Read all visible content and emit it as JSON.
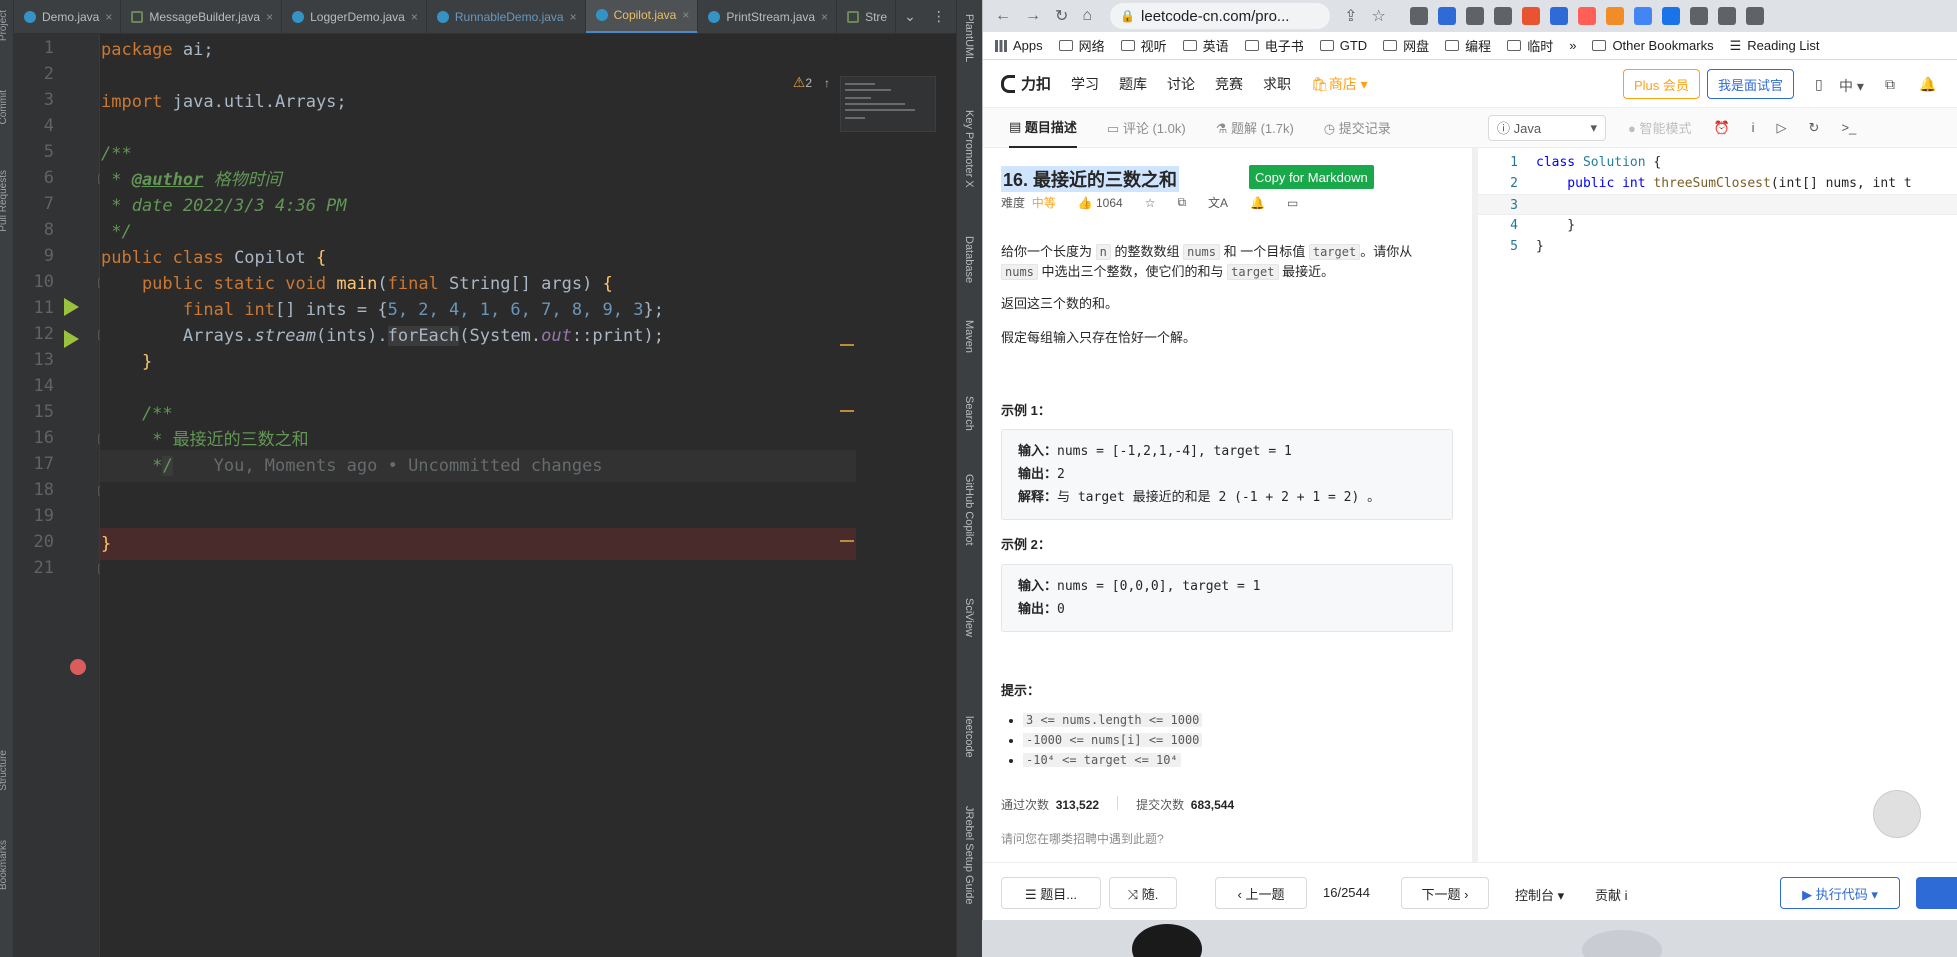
{
  "ide": {
    "tabs": [
      {
        "label": "Demo.java"
      },
      {
        "label": "MessageBuilder.java"
      },
      {
        "label": "LoggerDemo.java"
      },
      {
        "label": "RunnableDemo.java"
      },
      {
        "label": "Copilot.java"
      },
      {
        "label": "PrintStream.java"
      },
      {
        "label": "Stre"
      }
    ],
    "tab_close": "×",
    "tab_more": "⌄",
    "warning_count": "2",
    "left_tools": [
      "Project",
      "Commit",
      "Pull Requests",
      "Structure",
      "Bookmarks"
    ],
    "right_tools": [
      "PlantUML",
      "Key Promoter X",
      "Database",
      "Maven",
      "Search",
      "GitHub Copilot",
      "SciView",
      "leetcode",
      "JRebel Setup Guide"
    ],
    "line_numbers": [
      "1",
      "2",
      "3",
      "4",
      "5",
      "6",
      "7",
      "8",
      "9",
      "10",
      "11",
      "12",
      "13",
      "14",
      "15",
      "16",
      "17",
      "18",
      "19",
      "20",
      "21"
    ],
    "code": {
      "l1_kw": "package",
      "l1_rest": " ai;",
      "l3_kw": "import",
      "l3_rest": " java.util.Arrays;",
      "l5": "/**",
      "l6_a": " * ",
      "l6_ann": "@author",
      "l6_b": " 格物时间",
      "l7": " * date 2022/3/3 4:36 PM",
      "l8": " */",
      "l9_kw": "public class",
      "l9_name": " Copilot ",
      "l9_br": "{",
      "l10_kw": "    public static void",
      "l10_fn": " main",
      "l10_a": "(",
      "l10_kw2": "final",
      "l10_b": " String[] args) ",
      "l10_br": "{",
      "l11_kw": "        final int",
      "l11_a": "[] ints = {",
      "l11_nums": "5, 2, 4, 1, 6, 7, 8, 9, 3",
      "l11_b": "};",
      "l12_a": "        Arrays.",
      "l12_stream": "stream",
      "l12_b": "(ints).",
      "l12_fe": "forEach",
      "l12_c": "(System.",
      "l12_out": "out",
      "l12_d": "::print);",
      "l13": "    }",
      "l15": "    /**",
      "l16": "     * 最接近的三数之和",
      "l17_a": "     *",
      "l17_caret": "/",
      "l17_ghost": "    You, Moments ago • Uncommitted changes",
      "l20": "}"
    }
  },
  "browser": {
    "url": "leetcode-cn.com/pro...",
    "bookmarks": [
      "Apps",
      "网络",
      "视听",
      "英语",
      "电子书",
      "GTD",
      "网盘",
      "编程",
      "临时"
    ],
    "bookmarks_more": "»",
    "other_bookmarks": "Other Bookmarks",
    "reading_list": "Reading List",
    "nav": {
      "logo": "力扣",
      "items": [
        "学习",
        "题库",
        "讨论",
        "竞赛",
        "求职"
      ],
      "shop": "🛍商店 ▾",
      "plus": "Plus 会员",
      "interview": "我是面试官",
      "lang": "中 ▾"
    },
    "desc_tabs": [
      "题目描述",
      "评论 (1.0k)",
      "题解 (1.7k)",
      "提交记录"
    ],
    "code_toolbar": {
      "lang": "Java",
      "lang_caret": "▾",
      "smart": "● 智能模式",
      "icons": [
        "⏰",
        "i",
        "▷",
        "↻",
        ">_"
      ]
    },
    "question": {
      "title": "16. 最接近的三数之和",
      "copy_md": "Copy for Markdown",
      "difficulty_label": "难度",
      "difficulty": "中等",
      "likes": "👍 1064",
      "meta_icons": [
        "☆",
        "⧉",
        "文A",
        "🔔",
        "▭"
      ],
      "p1_a": "给你一个长度为 ",
      "p1_n": "n",
      "p1_b": " 的整数数组 ",
      "p1_nums": "nums",
      "p1_c": " 和 一个目标值 ",
      "p1_target": "target",
      "p1_d": "。请你从",
      "p1_nums2": "nums",
      "p1_e": " 中选出三个整数，使它们的和与 ",
      "p1_target2": "target",
      "p1_f": " 最接近。",
      "p2": "返回这三个数的和。",
      "p3": "假定每组输入只存在恰好一个解。",
      "ex1_title": "示例 1：",
      "ex1_in_label": "输入：",
      "ex1_in": "nums = [-1,2,1,-4], target = 1",
      "ex1_out_label": "输出：",
      "ex1_out": "2",
      "ex1_exp_label": "解释：",
      "ex1_exp": "与 target 最接近的和是 2 (-1 + 2 + 1 = 2) 。",
      "ex2_title": "示例 2：",
      "ex2_in_label": "输入：",
      "ex2_in": "nums = [0,0,0], target = 1",
      "ex2_out_label": "输出：",
      "ex2_out": "0",
      "hint_title": "提示：",
      "constraints": [
        "3 <= nums.length <= 1000",
        "-1000 <= nums[i] <= 1000",
        "-10⁴ <= target <= 10⁴"
      ],
      "passed_label": "通过次数",
      "passed": "313,522",
      "submitted_label": "提交次数",
      "submitted": "683,544",
      "ask": "请问您在哪类招聘中遇到此题?"
    },
    "editor": {
      "lines": [
        "1",
        "2",
        "3",
        "4",
        "5"
      ],
      "l1_kw": "class",
      "l1_ty": " Solution",
      "l1_rest": " {",
      "l2_kw": "    public int",
      "l2_fn": " threeSumClosest",
      "l2_rest": "(int[] nums, int t",
      "l4": "    }",
      "l5": "}"
    },
    "bottom": {
      "list": "☰ 题目...",
      "random": "⤨ 随.",
      "prev": "‹ 上一题",
      "page": "16/2544",
      "next": "下一题 ›",
      "console": "控制台 ▾",
      "contrib": "贡献 i",
      "run": "▶ 执行代码 ▾"
    }
  }
}
